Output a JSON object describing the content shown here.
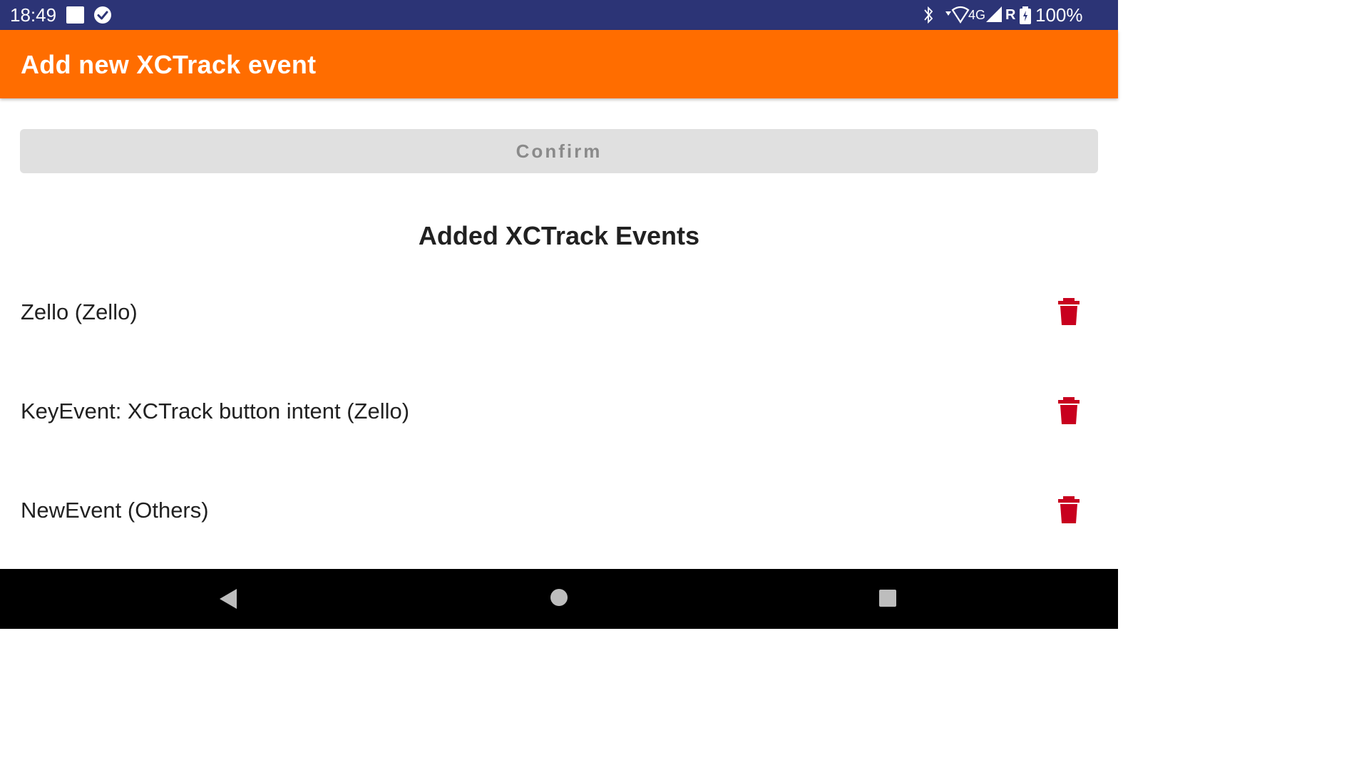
{
  "status_bar": {
    "time": "18:49",
    "network": "4G",
    "roaming": "R",
    "battery": "100%",
    "icons": [
      "notification-square-icon",
      "check-circle-icon",
      "bluetooth-icon",
      "wifi-icon",
      "signal-icon",
      "battery-charging-icon"
    ]
  },
  "app_bar": {
    "title": "Add new XCTrack event",
    "color": "#ff6d00"
  },
  "confirm_button": {
    "label": "Confirm"
  },
  "events_section": {
    "title": "Added XCTrack Events",
    "items": [
      {
        "label": "Zello (Zello)",
        "icon": "trash-icon"
      },
      {
        "label": "KeyEvent: XCTrack button intent (Zello)",
        "icon": "trash-icon"
      },
      {
        "label": "NewEvent (Others)",
        "icon": "trash-icon"
      }
    ],
    "delete_color": "#c8001e"
  },
  "nav_bar": {
    "icons": [
      "back-icon",
      "home-icon",
      "recents-icon"
    ]
  }
}
